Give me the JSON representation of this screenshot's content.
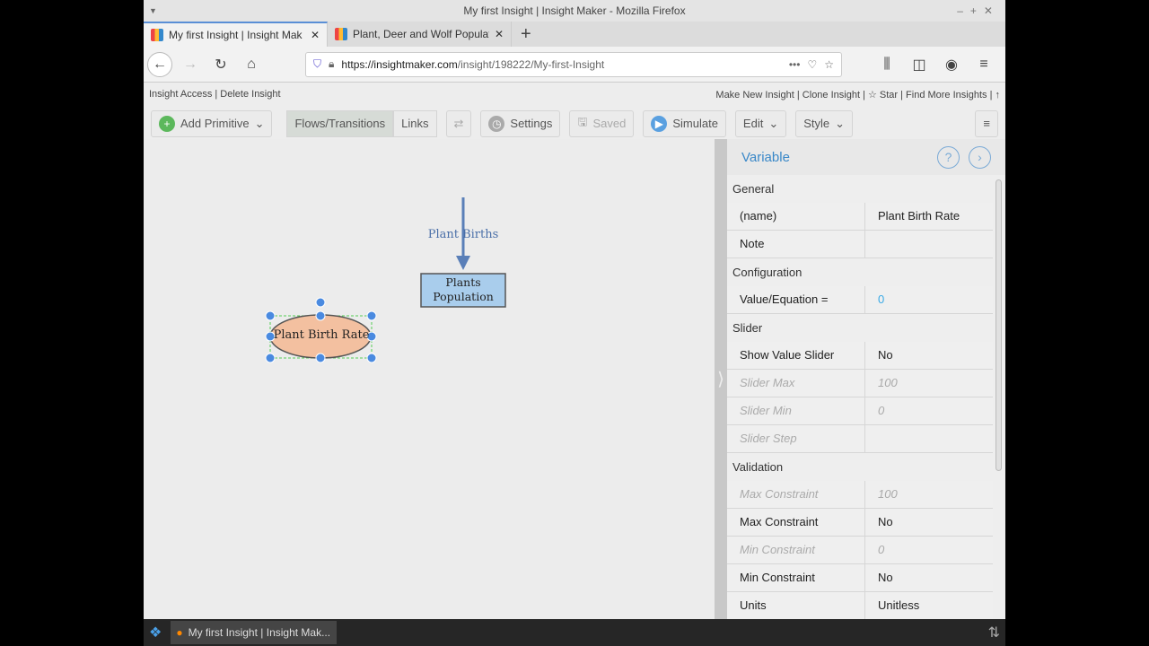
{
  "window": {
    "title": "My first Insight | Insight Maker - Mozilla Firefox"
  },
  "tabs": [
    {
      "label": "My first Insight | Insight Mak"
    },
    {
      "label": "Plant, Deer and Wolf Populat"
    }
  ],
  "url": {
    "host": "https://insightmaker.com",
    "path": "/insight/198222/My-first-Insight"
  },
  "links": {
    "left": "Insight Access | Delete Insight",
    "right": "Make New Insight | Clone Insight | ☆ Star | Find More Insights | ↑"
  },
  "toolbar": {
    "add_primitive": "Add Primitive",
    "flows": "Flows/Transitions",
    "links": "Links",
    "settings": "Settings",
    "saved": "Saved",
    "simulate": "Simulate",
    "edit": "Edit",
    "style": "Style"
  },
  "diagram": {
    "flow_label": "Plant Births",
    "stock": "Plants Population",
    "variable": "Plant Birth Rate"
  },
  "panel": {
    "title": "Variable",
    "groups": [
      {
        "name": "General",
        "rows": [
          {
            "k": "(name)",
            "v": "Plant Birth Rate"
          },
          {
            "k": "Note",
            "v": ""
          }
        ]
      },
      {
        "name": "Configuration",
        "rows": [
          {
            "k": "Value/Equation =",
            "v": "0",
            "blue": true
          }
        ]
      },
      {
        "name": "Slider",
        "rows": [
          {
            "k": "Show Value Slider",
            "v": "No"
          },
          {
            "k": "Slider Max",
            "v": "100",
            "dim": true
          },
          {
            "k": "Slider Min",
            "v": "0",
            "dim": true
          },
          {
            "k": "Slider Step",
            "v": "",
            "dim": true
          }
        ]
      },
      {
        "name": "Validation",
        "rows": [
          {
            "k": "Max Constraint",
            "v": "100",
            "dim": true
          },
          {
            "k": "Max Constraint",
            "v": "No"
          },
          {
            "k": "Min Constraint",
            "v": "0",
            "dim": true
          },
          {
            "k": "Min Constraint",
            "v": "No"
          },
          {
            "k": "Units",
            "v": "Unitless"
          }
        ]
      }
    ]
  },
  "taskbar": {
    "task": "My first Insight | Insight Mak..."
  }
}
